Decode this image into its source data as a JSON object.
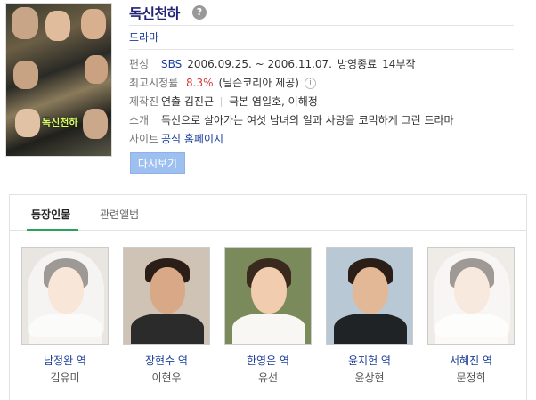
{
  "poster": {
    "overlay_text": "독신천하"
  },
  "header": {
    "title": "독신천하",
    "help_icon": "?",
    "genre": "드라마"
  },
  "details": {
    "broadcast": {
      "label": "편성",
      "channel": "SBS",
      "period": "2006.09.25. ~ 2006.11.07.",
      "status": "방영종료",
      "episodes": "14부작"
    },
    "rating": {
      "label": "최고시청률",
      "value": "8.3%",
      "source": "(닐슨코리아 제공)",
      "info_icon": "i"
    },
    "staff": {
      "label": "제작진",
      "director": "연출 김진근",
      "writer": "극본 염일호, 이해정"
    },
    "intro": {
      "label": "소개",
      "text": "독신으로 살아가는 여섯 남녀의 일과 사랑을 코믹하게 그린 드라마"
    },
    "site": {
      "label": "사이트",
      "link": "공식 홈페이지"
    }
  },
  "buttons": {
    "rewatch": "다시보기"
  },
  "tabs": [
    {
      "label": "등장인물",
      "active": true
    },
    {
      "label": "관련앨범",
      "active": false
    }
  ],
  "cast": [
    {
      "role": "남정완 역",
      "actor": "김유미"
    },
    {
      "role": "장현수 역",
      "actor": "이현우"
    },
    {
      "role": "한영은 역",
      "actor": "유선"
    },
    {
      "role": "윤지헌 역",
      "actor": "윤상현"
    },
    {
      "role": "서혜진 역",
      "actor": "문정희"
    }
  ],
  "colors": {
    "link": "#1a3d9a",
    "rating": "#d43c3c",
    "button": "#9ec0f0",
    "tab_underline": "#27a35a"
  }
}
